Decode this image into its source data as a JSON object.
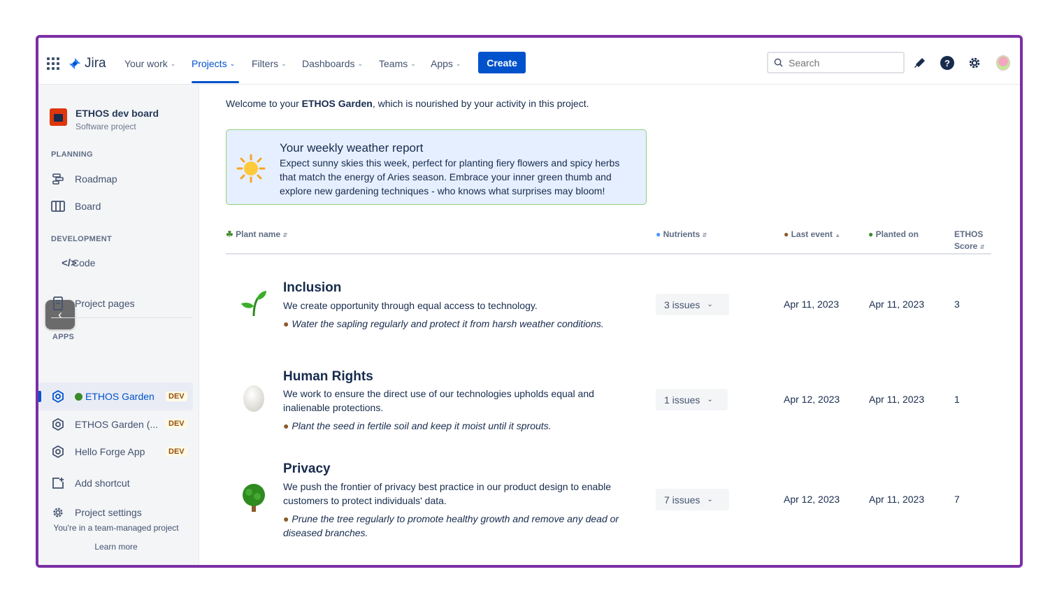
{
  "topnav": {
    "logo": "Jira",
    "items": [
      {
        "label": "Your work"
      },
      {
        "label": "Projects"
      },
      {
        "label": "Filters"
      },
      {
        "label": "Dashboards"
      },
      {
        "label": "Teams"
      },
      {
        "label": "Apps"
      }
    ],
    "active_item": "Projects",
    "create_label": "Create",
    "search_placeholder": "Search"
  },
  "sidebar": {
    "project_name": "ETHOS dev board",
    "project_type": "Software project",
    "sections": {
      "planning": "PLANNING",
      "development": "DEVELOPMENT",
      "apps": "APPS"
    },
    "items": {
      "roadmap": "Roadmap",
      "board": "Board",
      "code": "Code",
      "project_pages": "Project pages",
      "ethos_garden": "ETHOS Garden",
      "ethos_garden_2": "ETHOS Garden (...",
      "hello_forge": "Hello Forge App",
      "add_shortcut": "Add shortcut",
      "project_settings": "Project settings"
    },
    "badge": "DEV",
    "footer_text": "You're in a team-managed project",
    "footer_link": "Learn more"
  },
  "main": {
    "welcome_prefix": "Welcome to your ",
    "welcome_bold": "ETHOS Garden",
    "welcome_suffix": ", which is nourished by your activity in this project.",
    "weather": {
      "title": "Your weekly weather report",
      "body": "Expect sunny skies this week, perfect for planting fiery flowers and spicy herbs that match the energy of Aries season. Embrace your inner green thumb and explore new gardening techniques - who knows what surprises may bloom!"
    },
    "columns": {
      "plant_name": "Plant name",
      "nutrients": "Nutrients",
      "last_event": "Last event",
      "planted_on": "Planted on",
      "ethos_score_1": "ETHOS",
      "ethos_score_2": "Score"
    },
    "rows": [
      {
        "title": "Inclusion",
        "desc": "We create opportunity through equal access to technology.",
        "tip": "Water the sapling regularly and protect it from harsh weather conditions.",
        "issues": "3 issues",
        "last_event": "Apr 11, 2023",
        "planted_on": "Apr 11, 2023",
        "score": "3",
        "icon": "sprout-icon"
      },
      {
        "title": "Human Rights",
        "desc": "We work to ensure the direct use of our technologies upholds equal and inalienable protections.",
        "tip": "Plant the seed in fertile soil and keep it moist until it sprouts.",
        "issues": "1 issues",
        "last_event": "Apr 12, 2023",
        "planted_on": "Apr 11, 2023",
        "score": "1",
        "icon": "seed-icon"
      },
      {
        "title": "Privacy",
        "desc": "We push the frontier of privacy best practice in our product design to enable customers to protect individuals' data.",
        "tip": "Prune the tree regularly to promote healthy growth and remove any dead or diseased branches.",
        "issues": "7 issues",
        "last_event": "Apr 12, 2023",
        "planted_on": "Apr 11, 2023",
        "score": "7",
        "icon": "tree-icon"
      }
    ]
  },
  "colors": {
    "frame_border": "#7b2fa5",
    "primary": "#0052cc",
    "weather_bg": "#e6efff",
    "weather_border": "#8fd27a"
  }
}
